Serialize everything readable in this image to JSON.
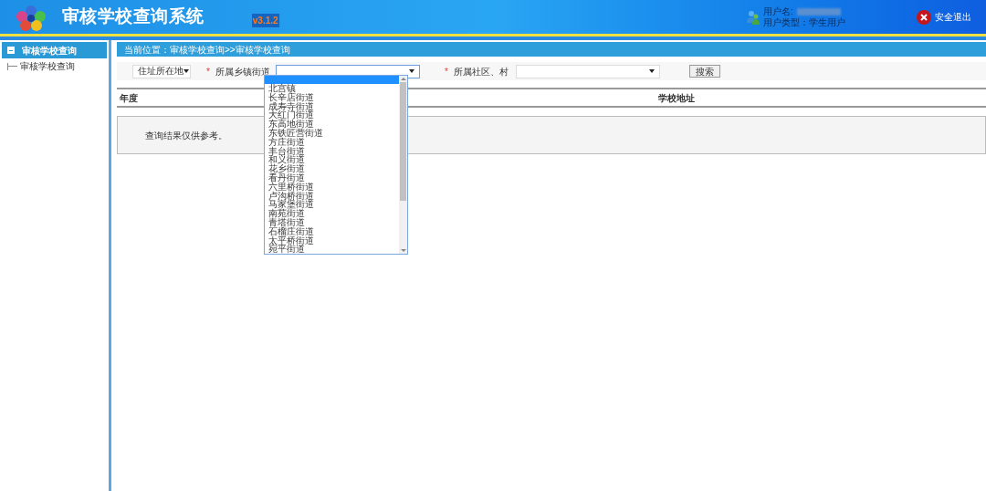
{
  "header": {
    "title": "审核学校查询系统",
    "version": "v3.1.2",
    "user_label": "用户名:",
    "user_type": "用户类型：学生用户",
    "logout": "安全退出"
  },
  "sidebar": {
    "heading": {
      "label": "审核学校查询",
      "expanded": true
    },
    "items": [
      {
        "label": "审核学校查询"
      }
    ]
  },
  "breadcrumb": "当前位置：审核学校查询>>审核学校查询",
  "filters": {
    "address_select": "住址所在地",
    "required_mark": "*",
    "street_label": "所属乡镇街道",
    "community_label": "所属社区、村",
    "search_button": "搜索"
  },
  "street_dropdown": {
    "open": true,
    "blank_option_highlighted": true,
    "options": [
      {
        "label": "北宫镇"
      },
      {
        "label": "长辛店街道"
      },
      {
        "label": "成寿寺街道"
      },
      {
        "label": "大红门街道"
      },
      {
        "label": "东高地街道"
      },
      {
        "label": "东铁匠营街道"
      },
      {
        "label": "方庄街道"
      },
      {
        "label": "丰台街道"
      },
      {
        "label": "和义街道"
      },
      {
        "label": "花乡街道"
      },
      {
        "label": "看丹街道"
      },
      {
        "label": "六里桥街道"
      },
      {
        "label": "卢沟桥街道"
      },
      {
        "label": "马家堡街道"
      },
      {
        "label": "南苑街道"
      },
      {
        "label": "青塔街道"
      },
      {
        "label": "石榴庄街道"
      },
      {
        "label": "太平桥街道"
      },
      {
        "label": "宛平街道"
      }
    ]
  },
  "table": {
    "columns": [
      "年度",
      "学校地址"
    ]
  },
  "note": "查询结果仅供参考。"
}
